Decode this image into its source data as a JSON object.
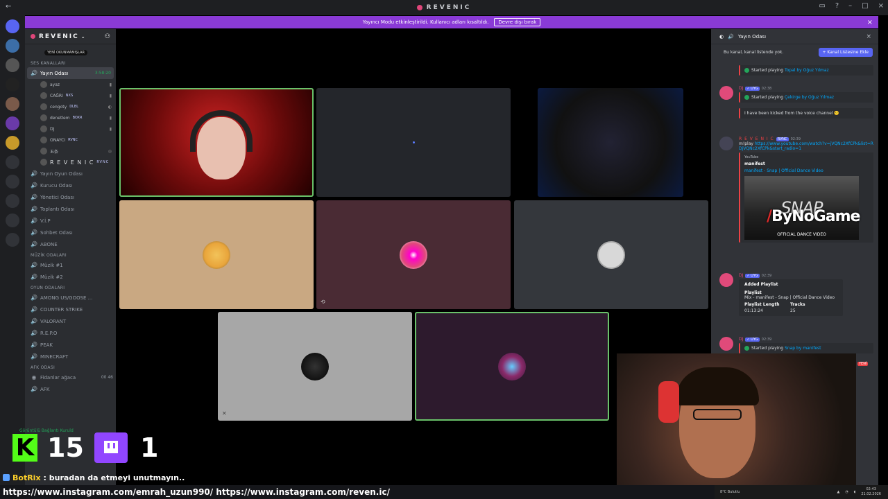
{
  "app": {
    "title": "REVENIC",
    "back": "←"
  },
  "window_controls": [
    "▭",
    "?",
    "–",
    "□",
    "×"
  ],
  "notice": {
    "text": "Yayıncı Modu etkinleştirildi. Kullanıcı adları kısaltıldı.",
    "button": "Devre dışı bırak",
    "close": "×"
  },
  "server": {
    "name": "REVENIC",
    "new_badge": "YENİ OKUNMAMIŞLAR",
    "add_people_icon": "person-add-icon"
  },
  "sidebar": {
    "voice_category": "SES KANALLARI",
    "active_channel": {
      "name": "Yayın Odası",
      "time": "3:58:20"
    },
    "users": [
      {
        "name": "ayaz",
        "tag": ""
      },
      {
        "name": "CAĞRI",
        "tag": "NXS"
      },
      {
        "name": "cengoty",
        "tag": "DLBL"
      },
      {
        "name": "denetlem",
        "tag": "BOXR"
      },
      {
        "name": "DJ",
        "tag": ""
      },
      {
        "name": "ONAYCI",
        "tag": "RVNC"
      },
      {
        "name": "五条",
        "tag": ""
      },
      {
        "name": "R E V E N I C",
        "tag": "RVNC"
      }
    ],
    "channels": [
      "Yayın Oyun Odası",
      "Kurucu Odası",
      "Yönetici Odası",
      "Toplantı Odası",
      "V.İ.P",
      "Sohbet Odası",
      "ABONE"
    ],
    "music_category": "MÜZİK ODALARI",
    "music_channels": [
      "Müzik #1",
      "Müzik #2"
    ],
    "game_category": "OYUN ODALARI",
    "game_channels": [
      "AMONG US/GOOSE ...",
      "COUNTER STRIKE",
      "VALORANT",
      "R.E.P.O",
      "PEAK",
      "MINECRAFT"
    ],
    "afk_category": "AFK ODASI",
    "afk_channels": [
      {
        "name": "Fidanlar ağaca",
        "count": "00 46"
      },
      {
        "name": "AFK",
        "count": ""
      }
    ],
    "connected": "Görüntülü Bağlantı Kuruld"
  },
  "panel": {
    "title": "Yayın Odası",
    "info": "Bu kanal, kanal listende yok.",
    "add_button": "+ Kanal Listesine Ekle",
    "messages": [
      {
        "kind": "embed_only",
        "text_prefix": "Started playing ",
        "link": "Topal by Oğuz Yılmaz"
      },
      {
        "kind": "msg",
        "name": "DJ",
        "tag": "✓ UYG",
        "time": "02:38",
        "text_prefix": "Started playing ",
        "link": "Çekirge by Oğuz Yılmaz"
      },
      {
        "kind": "embed_only",
        "text": "I have been kicked from the voice channel 🙁"
      },
      {
        "kind": "msg",
        "name": "R E V E N I C",
        "tag": "RVNC",
        "time": "02:39",
        "text": "m!play",
        "url": "https://www.youtube.com/watch?v=jVQNc2XfCPk&list=RDjVQNc2XfCPk&start_radio=1",
        "yt_label": "YouTube",
        "yt_author": "manifest",
        "yt_title": "manifest - Snap | Official Dance Video",
        "thumb_text": "SNAP",
        "thumb_sub": "OFFICIAL DANCE VIDEO"
      },
      {
        "kind": "msg",
        "name": "DJ",
        "tag": "✓ UYG",
        "time": "02:39",
        "title": "Added Playlist",
        "playlist_label": "Playlist",
        "playlist": "Mix - manifest - Snap | Official Dance Video",
        "len_label": "Playlist Length",
        "len": "01:13:24",
        "tracks_label": "Tracks",
        "tracks": "25"
      },
      {
        "kind": "msg",
        "name": "DJ",
        "tag": "✓ UYG",
        "time": "02:39",
        "text_prefix": "Started playing ",
        "link": "Snap by manifest"
      }
    ],
    "side_badge": "YENİ"
  },
  "watermark": "ByNoGame",
  "overlay": {
    "kick_logo": "K",
    "kick_count": "15",
    "twitch_count": "1",
    "chat_user": "BotRix",
    "chat_text": ": buradan da etmeyi unutmayın..",
    "ticker": "https://www.instagram.com/emrah_uzun990/ https://www.instagram.com/reven.ic/",
    "weather": "8°C Bulutlu",
    "clock_time": "02:43",
    "clock_date": "21.02.2026"
  }
}
